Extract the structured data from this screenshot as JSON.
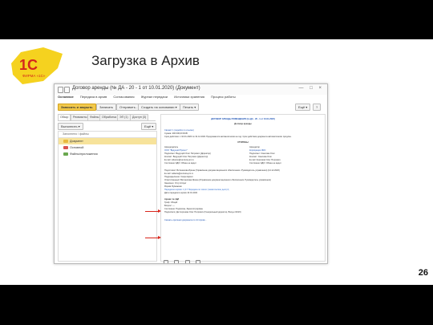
{
  "slide": {
    "title": "Загрузка в Архив",
    "page_number": "26",
    "logo_text": "1С ФИРМА «1С»"
  },
  "window": {
    "title": "Договор аренды (№ ДА - 20 - 1 от 10.01.2020) (Документ)",
    "controls": "— □ ×",
    "links": [
      "Основное",
      "Передача в архив",
      "Согласования",
      "Журнал передачи",
      "Источники хранения",
      "Процесс работы"
    ],
    "toolbar": {
      "primary": "Записать и закрыть",
      "buttons": [
        "Записать",
        "Отправить…",
        "Создать на основании ▾",
        "Печать ▾"
      ],
      "more": "Ещё ▾",
      "help": "?"
    }
  },
  "left": {
    "tabs": [
      "Обзор",
      "Реквизиты",
      "Файлы",
      "Обработка",
      "ЭП (1)",
      "Доступ (3)"
    ],
    "subbar_button": "Выполнить ▾",
    "subbar_more": "Ещё ▾",
    "tree_header": "Заполнено / файлы",
    "folders": [
      {
        "label": "Документ",
        "selected": true
      },
      {
        "label": "Основной",
        "selected": false
      },
      {
        "label": "Файлы/приложения",
        "selected": false
      }
    ]
  },
  "doc": {
    "heading": "ДОГОВОР АРЕНДЫ ПОМЕЩЕНИЯ (№ ДА - 20 - 1 от 10.01.2020)",
    "subheading": "Договор аренды",
    "section1": "Связей: 1 (перейти по ссылке)",
    "amount": "Сумма: 200 000,00 RUB",
    "period": "Срок действия: с 10.01.2020 по 31.12.2021 Продлевается автоматически на год. Срок действия документа автоматически продлен.",
    "parties_label": "СТОРОНЫ",
    "left_party": [
      "Арендодатель",
      "ООО \"Ведущий Проект\"",
      "Подписант: Ведущий Олег Петрович (Директор)",
      "Контакт: Ведущий Олег Петрович (Директор)",
      "E-mail: reliance@ventura-pro.ru",
      "Состояние ЭДО: Обмен не ведет"
    ],
    "right_party": [
      "Арендатор",
      "Корпорация ФКС",
      "Подписант: Смелова Олег",
      "Контакт: Смелова Олег",
      "E-mail: Корсиков Олег Петрович",
      "Состояние ЭДО: Обмен не ведет"
    ],
    "prepared": [
      "Подготовил: Витиникова Ирина (Управление документационного обеспечения. Руководитель управления) (14.12.2020)",
      "E-mail: vellavia@ventura-pro.ru",
      "Подразделение: Секретариат",
      "Ответственный: Витиникова Ирина (Управление документационного обеспечения. Руководитель управления)",
      "Занесено: Отсутствует",
      "Форма: Бумажная",
      "Передача в архив: 1 (17 Передача по описи (тематическое дело) 1)",
      "Дата передачи в архив 10.01.2021"
    ],
    "file_block": [
      "Архив: № 1ДА",
      "Гриф: Общий",
      "Вопрос: —",
      "Состояние: Подписан, Зарегистрирован",
      "Подписали: Да Сергеева Олег Петрович (Генеральный директор, Вход-к 04/23)"
    ],
    "link": "Скачать оригинал документа по 1С:Архив..."
  }
}
